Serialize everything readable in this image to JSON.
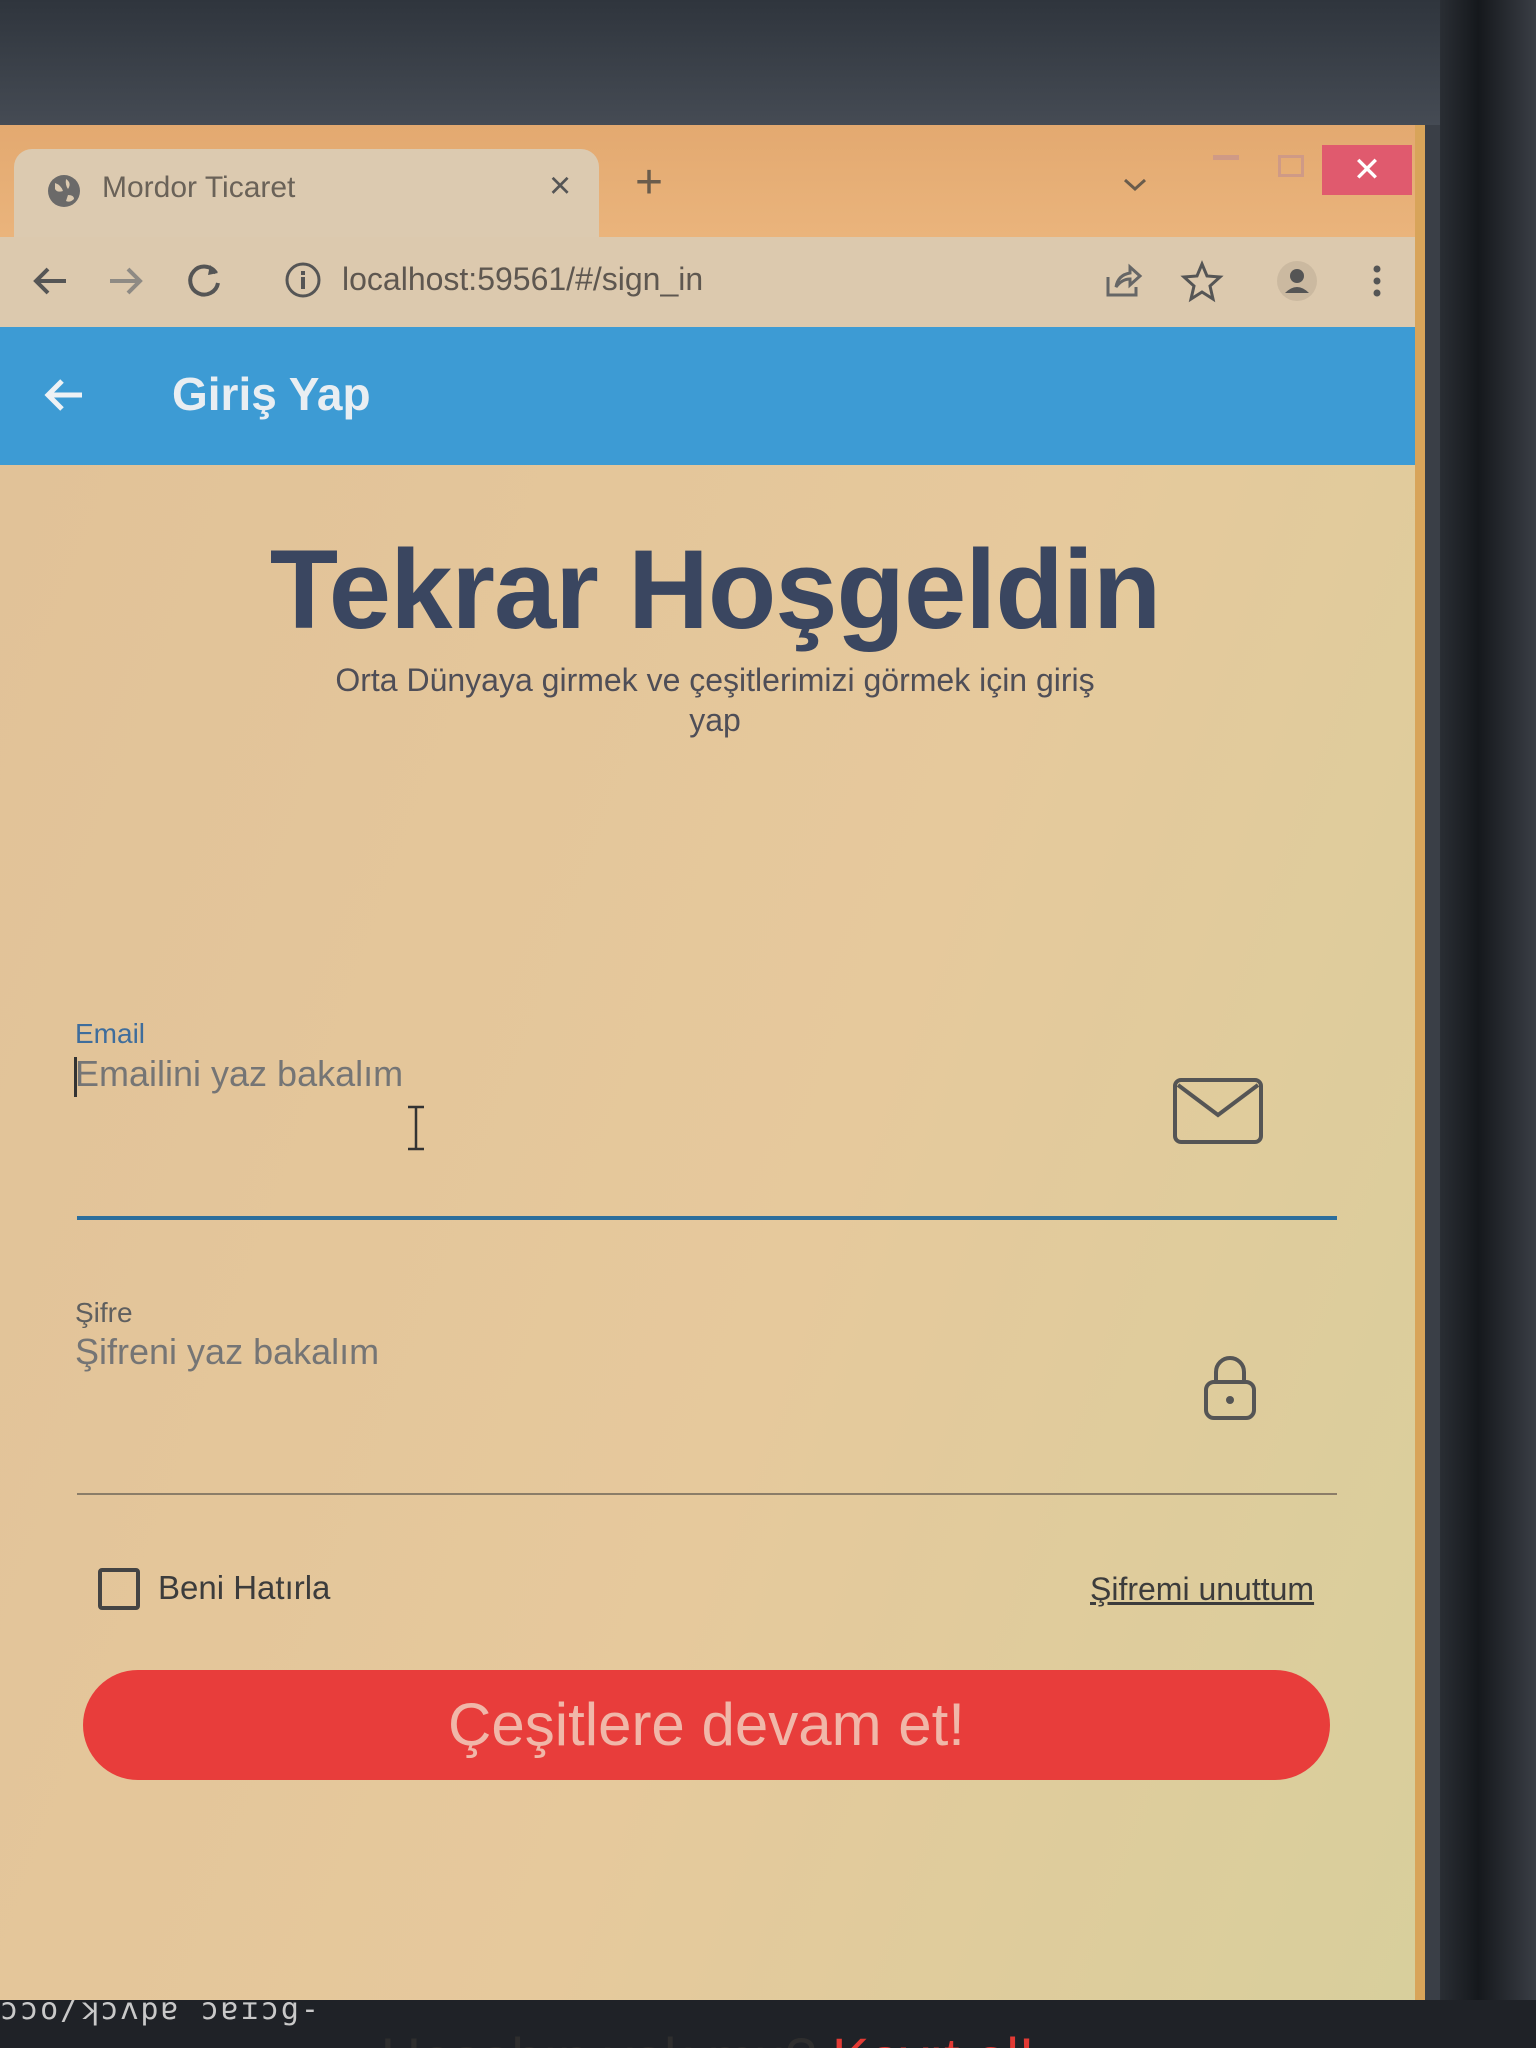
{
  "browser": {
    "tab_title": "Mordor Ticaret",
    "tab_close": "×",
    "new_tab": "+",
    "close_window": "✕",
    "address": "localhost:59561/#/sign_in"
  },
  "appbar": {
    "title": "Giriş Yap",
    "color": "#3d9bd4"
  },
  "welcome": {
    "title": "Tekrar Hoşgeldin",
    "subtitle": "Orta Dünyaya girmek ve çeşitlerimizi görmek için giriş yap"
  },
  "form": {
    "email_label": "Email",
    "email_placeholder": "Emailini yaz bakalım",
    "password_label": "Şifre",
    "password_placeholder": "Şifreni yaz bakalım",
    "remember_label": "Beni Hatırla",
    "remember_checked": false,
    "forgot_label": "Şifremi unuttum",
    "submit_label": "Çeşitlere devam et!",
    "submit_color": "#e83d3b"
  },
  "signup": {
    "prompt": "Hesabın yok mu?",
    "link": "Kayıt ol!"
  },
  "bezel_text": "ɔɔo/ʞɔʌpɐ ɔɐɪɔg-"
}
